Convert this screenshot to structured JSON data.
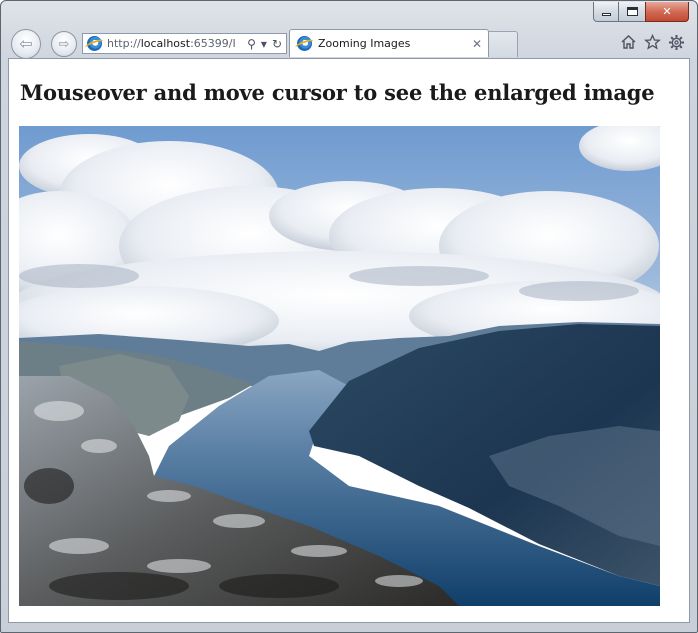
{
  "browser": {
    "address": {
      "scheme": "http://",
      "host": "localhost",
      "rest": ":65399/I",
      "search_glyph": "⚲",
      "dropdown_glyph": "▾",
      "refresh_glyph": "↻"
    },
    "tab": {
      "title": "Zooming Images",
      "close_glyph": "✕"
    },
    "nav": {
      "back_glyph": "⇦",
      "forward_glyph": "⇨"
    },
    "caption": {
      "close_glyph": "✕"
    },
    "icons": [
      "home-icon",
      "favorites-star-icon",
      "tools-gear-icon"
    ]
  },
  "page": {
    "heading": "Mouseover and move cursor to see the enlarged image",
    "image": {
      "subject": "fjord-landscape",
      "colors": {
        "sky": "#7fa6d4",
        "cloud": "#eef1f5",
        "water": "#3f6a93",
        "rock": "#4a4a48",
        "cliff_dark": "#1c3a55"
      }
    }
  }
}
